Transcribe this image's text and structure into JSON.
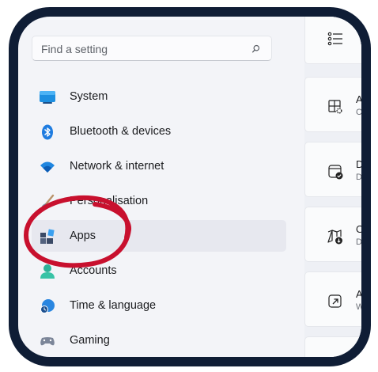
{
  "search": {
    "placeholder": "Find a setting"
  },
  "sidebar": {
    "items": [
      {
        "label": "System",
        "icon": "monitor-icon"
      },
      {
        "label": "Bluetooth & devices",
        "icon": "bluetooth-icon"
      },
      {
        "label": "Network & internet",
        "icon": "wifi-icon"
      },
      {
        "label": "Personalisation",
        "icon": "brush-icon"
      },
      {
        "label": "Apps",
        "icon": "apps-icon",
        "selected": true
      },
      {
        "label": "Accounts",
        "icon": "person-icon"
      },
      {
        "label": "Time & language",
        "icon": "globe-clock-icon"
      },
      {
        "label": "Gaming",
        "icon": "gamepad-icon"
      }
    ]
  },
  "right_cards": [
    {
      "title": "",
      "subtitle": "",
      "icon": "list-icon"
    },
    {
      "title": "A",
      "subtitle": "C",
      "icon": "apps-settings-icon"
    },
    {
      "title": "D",
      "subtitle": "De",
      "icon": "default-apps-icon"
    },
    {
      "title": "O",
      "subtitle": "Do",
      "icon": "offline-maps-icon"
    },
    {
      "title": "A",
      "subtitle": "W",
      "icon": "open-external-icon"
    },
    {
      "title": "",
      "subtitle": "",
      "icon": "video-icon"
    }
  ],
  "colors": {
    "frame": "#0f1d35",
    "annotation_circle": "#c8102e",
    "selected_bg": "#e7e8ef"
  }
}
